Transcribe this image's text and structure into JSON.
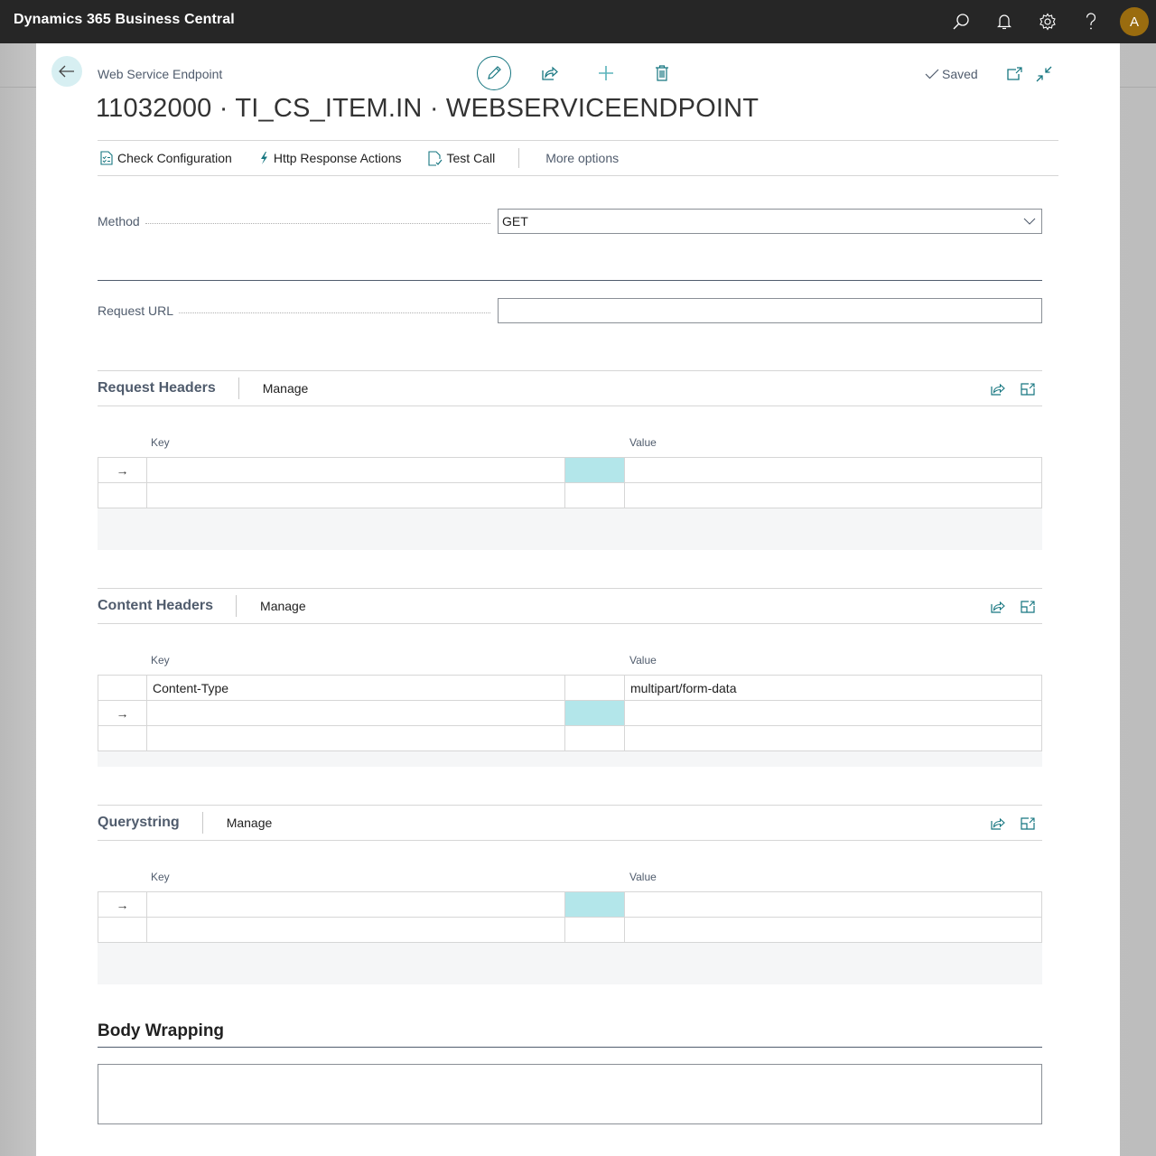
{
  "app": {
    "title": "Dynamics 365 Business Central",
    "user_initial": "A",
    "icons": [
      "search-icon",
      "bell-icon",
      "gear-icon",
      "help-icon"
    ]
  },
  "header": {
    "breadcrumb": "Web Service Endpoint",
    "title": "11032000 · TI_CS_ITEM.IN · WEBSERVICEENDPOINT",
    "saved_label": "Saved",
    "actions": [
      "edit-icon",
      "share-icon",
      "add-icon",
      "delete-icon"
    ]
  },
  "actionbar": {
    "items": [
      {
        "label": "Check Configuration",
        "icon": "checklist-icon"
      },
      {
        "label": "Http Response Actions",
        "icon": "lightning-icon"
      },
      {
        "label": "Test Call",
        "icon": "document-check-icon"
      }
    ],
    "more": "More options"
  },
  "fields": {
    "method": {
      "label": "Method",
      "value": "GET"
    },
    "request_url": {
      "label": "Request URL",
      "value": ""
    }
  },
  "parts": {
    "request_headers": {
      "title": "Request Headers",
      "manage": "Manage",
      "columns": {
        "key": "Key",
        "value": "Value"
      },
      "rows": [
        {
          "indicator": "→",
          "key": "",
          "value": "",
          "active": true
        },
        {
          "indicator": "",
          "key": "",
          "value": "",
          "active": false
        }
      ]
    },
    "content_headers": {
      "title": "Content Headers",
      "manage": "Manage",
      "columns": {
        "key": "Key",
        "value": "Value"
      },
      "rows": [
        {
          "indicator": "",
          "key": "Content-Type",
          "value": "multipart/form-data",
          "active": false
        },
        {
          "indicator": "→",
          "key": "",
          "value": "",
          "active": true
        },
        {
          "indicator": "",
          "key": "",
          "value": "",
          "active": false
        }
      ]
    },
    "querystring": {
      "title": "Querystring",
      "manage": "Manage",
      "columns": {
        "key": "Key",
        "value": "Value"
      },
      "rows": [
        {
          "indicator": "→",
          "key": "",
          "value": "",
          "active": true
        },
        {
          "indicator": "",
          "key": "",
          "value": "",
          "active": false
        }
      ]
    }
  },
  "body_wrapping": {
    "title": "Body Wrapping",
    "value": ""
  },
  "colors": {
    "accent": "#167680",
    "active_cell": "#b3e6ea",
    "topbar": "#262626",
    "avatar": "#9a6c0f"
  }
}
